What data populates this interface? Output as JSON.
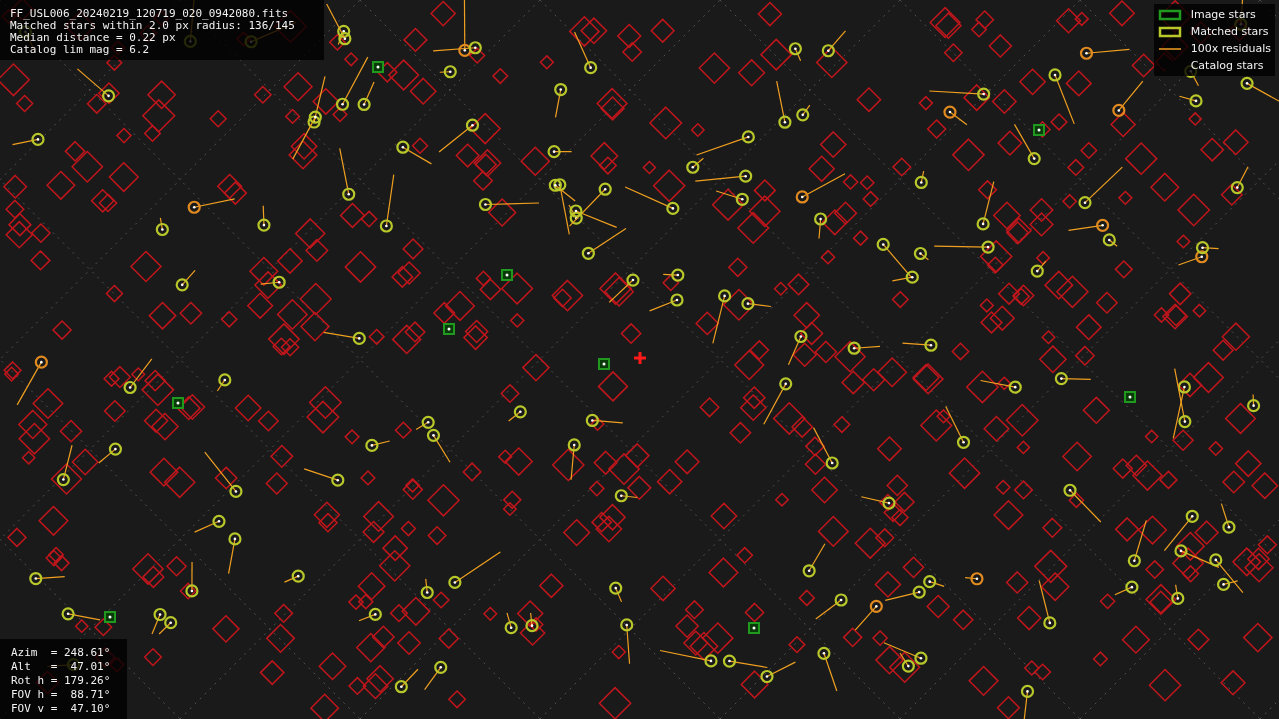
{
  "info_panel": {
    "lines": [
      "FF_USL006_20240219_120719_020_0942080.fits",
      "Matched stars within 2.0 px radius: 136/145",
      "Median distance = 0.22 px",
      "Catalog lim mag = 6.2"
    ]
  },
  "legend": [
    {
      "kind": "image",
      "label": "Image stars"
    },
    {
      "kind": "matched",
      "label": "Matched stars"
    },
    {
      "kind": "residual",
      "label": "100x residuals"
    },
    {
      "kind": "catalog",
      "label": "Catalog stars"
    }
  ],
  "pointing_panel": {
    "lines": [
      "Azim  = 248.61°",
      "Alt   =  47.01°",
      "Rot h = 179.26°",
      "FOV h =  88.71°",
      "FOV v =  47.10°"
    ]
  }
}
